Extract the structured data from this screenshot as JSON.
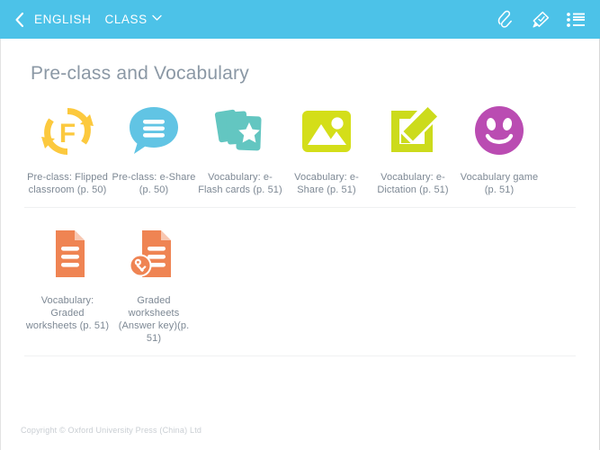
{
  "topbar": {
    "back_icon": "chevron-left-icon",
    "breadcrumb_subject": "ENGLISH",
    "breadcrumb_level": "CLASS",
    "caret_icon": "chevron-down-icon",
    "actions": [
      {
        "name": "paperclip-icon",
        "label": "Attachments"
      },
      {
        "name": "stamp-icon",
        "label": "Stamp"
      },
      {
        "name": "list-icon",
        "label": "Contents list"
      }
    ],
    "bar_color": "#4cc2e8",
    "text_color": "#ffffff"
  },
  "main": {
    "title": "Pre-class and Vocabulary",
    "title_color": "#8b98a5",
    "rows": [
      {
        "tiles": [
          {
            "icon": "flipped-classroom-icon",
            "color": "#fcc93e",
            "label": "Pre-class: Flipped classroom (p. 50)"
          },
          {
            "icon": "eshare-chat-icon",
            "color": "#61c4e4",
            "label": "Pre-class: e-Share (p. 50)"
          },
          {
            "icon": "flashcards-icon",
            "color": "#63c6c1",
            "label": "Vocabulary: e-Flash cards (p. 51)"
          },
          {
            "icon": "image-icon",
            "color": "#d4de19",
            "label": "Vocabulary: e-Share (p. 51)"
          },
          {
            "icon": "edit-square-icon",
            "color": "#ccdb1c",
            "label": "Vocabulary: e-Dictation (p. 51)"
          },
          {
            "icon": "smiley-face-icon",
            "color": "#ba4cb2",
            "label": "Vocabulary game (p. 51)"
          }
        ]
      },
      {
        "tiles": [
          {
            "icon": "document-icon",
            "color": "#ef8453",
            "label": "Vocabulary: Graded worksheets (p. 51)"
          },
          {
            "icon": "document-key-icon",
            "color": "#ef8453",
            "label": "Graded worksheets (Answer key)(p. 51)"
          }
        ]
      }
    ]
  },
  "footer": {
    "copyright": "Copyright © Oxford University Press (China) Ltd"
  }
}
